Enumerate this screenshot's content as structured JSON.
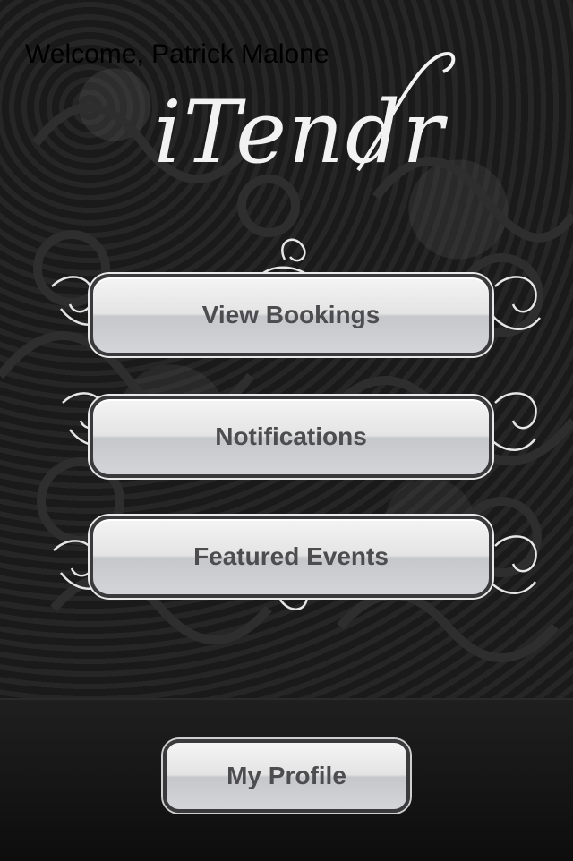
{
  "header": {
    "welcome_text": "Welcome, Patrick Malone",
    "logo_text": "iTendr"
  },
  "menu": {
    "items": [
      {
        "label": "View Bookings"
      },
      {
        "label": "Notifications"
      },
      {
        "label": "Featured Events"
      }
    ]
  },
  "footer": {
    "profile_label": "My Profile"
  },
  "colors": {
    "background": "#1c1c1c",
    "button_text": "#4d4d50",
    "logo": "#f2f2f2"
  }
}
